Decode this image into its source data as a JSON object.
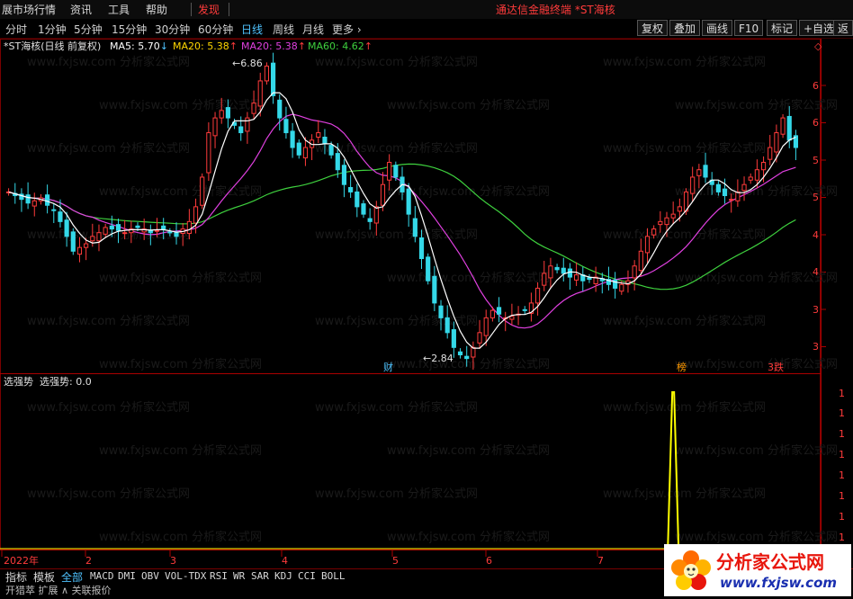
{
  "menu": {
    "items": [
      "展市场行情",
      "资讯",
      "工具",
      "帮助"
    ],
    "discover": "发现",
    "window_title": "通达信金融终端  *ST海核"
  },
  "periods": [
    "分时",
    "1分钟",
    "5分钟",
    "15分钟",
    "30分钟",
    "60分钟",
    "日线",
    "周线",
    "月线",
    "更多 ›"
  ],
  "active_period": "日线",
  "toolbar": [
    "复权",
    "叠加",
    "画线",
    "F10",
    "标记",
    "+自选",
    "返"
  ],
  "main_chart": {
    "stock_title": "*ST海核(日线 前复权)",
    "ma": [
      {
        "name": "MA5",
        "value": "5.70",
        "arrow": "↓",
        "color": "#ffffff"
      },
      {
        "name": "MA20",
        "value": "5.38",
        "arrow": "↑",
        "color": "#ffd700"
      },
      {
        "name": "MA20",
        "value": "5.38",
        "arrow": "↑",
        "color": "#e040e0"
      },
      {
        "name": "MA60",
        "value": "4.62",
        "arrow": "↑",
        "color": "#3ed03e"
      }
    ],
    "high_label": "6.86",
    "low_label": "2.84",
    "y_ticks": [
      "6",
      "6",
      "5",
      "5",
      "4",
      "4",
      "3",
      "3"
    ],
    "markers": [
      {
        "text": "财",
        "color": "#4fc3ff"
      },
      {
        "text": "榜",
        "color": "#ff9900"
      },
      {
        "text": "3跌",
        "color": "#ff3b3b"
      }
    ],
    "x_ticks": [
      "2022年",
      "2",
      "3",
      "4",
      "5",
      "6",
      "7",
      "8"
    ],
    "watermark": "www.fxjsw.com 分析家公式网"
  },
  "indicator": {
    "title": "选强势",
    "series_label": "选强势: 0.0",
    "y_ticks": [
      "1",
      "1",
      "1",
      "1",
      "1",
      "1",
      "1",
      "1"
    ]
  },
  "indicator_tabs": {
    "cn": [
      "指标",
      "模板",
      "全部"
    ],
    "codes": [
      "MACD",
      "DMI",
      "OBV",
      "VOL-TDX",
      "RSI",
      "WR",
      "SAR",
      "KDJ",
      "CCI",
      "BOLL"
    ],
    "active": "全部"
  },
  "status": {
    "text": "开猎萃   扩展 ∧   关联报价"
  },
  "logo": {
    "text_cn": "分析家公式网",
    "text_url": "www.fxjsw.com"
  },
  "chart_data": {
    "type": "candlestick",
    "title": "*ST海核(日线 前复权)",
    "ylim": [
      2.7,
      7.0
    ],
    "x_ticks": [
      "2022年",
      "2",
      "3",
      "4",
      "5",
      "6",
      "7",
      "8"
    ],
    "close": [
      5.1,
      5.05,
      5.0,
      4.95,
      4.98,
      5.02,
      4.92,
      4.85,
      4.7,
      4.5,
      4.3,
      4.35,
      4.4,
      4.5,
      4.55,
      4.62,
      4.6,
      4.58,
      4.55,
      4.6,
      4.62,
      4.6,
      4.55,
      4.58,
      4.6,
      4.55,
      4.5,
      4.6,
      4.7,
      4.9,
      5.3,
      5.9,
      6.1,
      6.2,
      6.1,
      6.0,
      5.9,
      6.1,
      6.3,
      6.6,
      6.8,
      6.4,
      6.1,
      5.9,
      5.7,
      5.6,
      5.7,
      5.8,
      5.9,
      5.75,
      5.6,
      5.4,
      5.2,
      5.1,
      4.9,
      4.8,
      4.7,
      4.9,
      5.2,
      5.5,
      5.3,
      5.1,
      4.8,
      4.5,
      4.2,
      3.9,
      3.6,
      3.4,
      3.2,
      3.0,
      2.9,
      2.85,
      3.0,
      3.2,
      3.4,
      3.5,
      3.45,
      3.4,
      3.42,
      3.45,
      3.5,
      3.6,
      3.8,
      4.0,
      4.1,
      4.05,
      4.0,
      3.95,
      3.98,
      3.9,
      3.92,
      3.95,
      3.9,
      3.85,
      3.8,
      3.85,
      3.9,
      4.1,
      4.3,
      4.5,
      4.6,
      4.7,
      4.75,
      4.8,
      4.9,
      5.1,
      5.3,
      5.4,
      5.3,
      5.2,
      5.1,
      5.05,
      5.0,
      5.1,
      5.2,
      5.3,
      5.4,
      5.5,
      5.7,
      5.9,
      6.1,
      5.8,
      5.7
    ],
    "ma_series": [
      {
        "name": "MA5",
        "value": 5.7
      },
      {
        "name": "MA20",
        "value": 5.38
      },
      {
        "name": "MA60",
        "value": 4.62
      }
    ],
    "high": 6.86,
    "low": 2.84,
    "indicator": {
      "name": "选强势",
      "value": 0.0,
      "spike_index": 103
    }
  }
}
